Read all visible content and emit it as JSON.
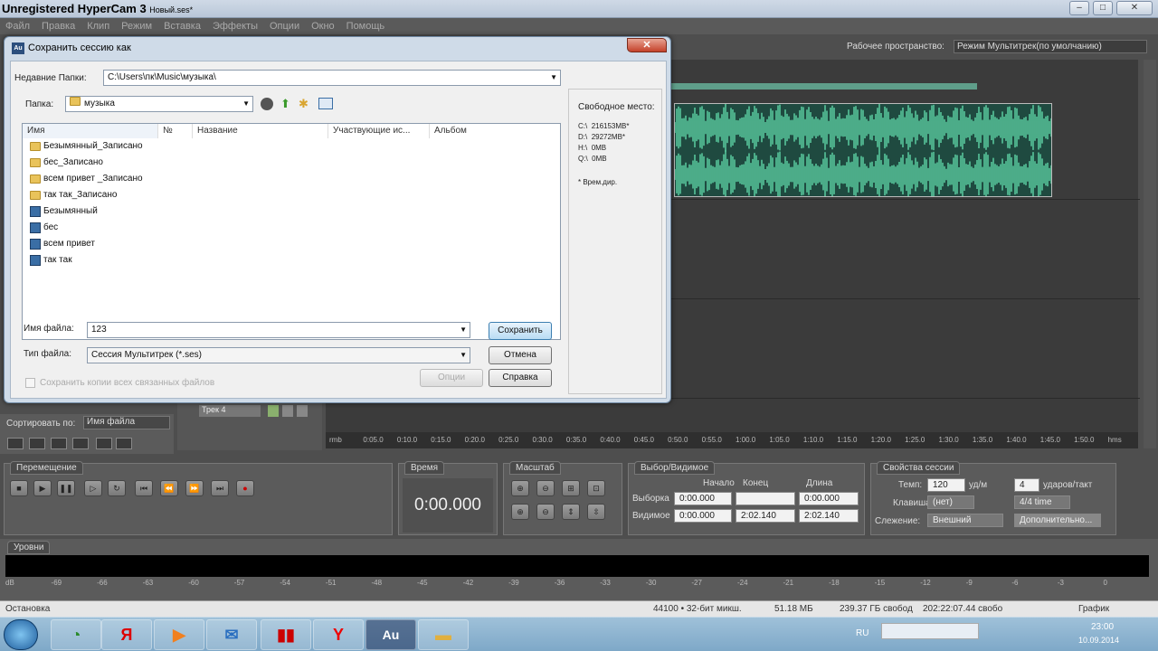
{
  "titlebar": {
    "app": "Unregistered HyperCam 3",
    "file": "Новый.ses*"
  },
  "menu": [
    "Файл",
    "Правка",
    "Клип",
    "Режим",
    "Вставка",
    "Эффекты",
    "Опции",
    "Окно",
    "Помощь"
  ],
  "workspace": {
    "label": "Рабочее пространство:",
    "value": "Режим Мультитрек(по умолчанию)"
  },
  "files_panel": {
    "sort_label": "Сортировать по:",
    "sort_value": "Имя файла"
  },
  "track": {
    "name": "Трек 4"
  },
  "ruler": [
    "rmb",
    "0:05.0",
    "0:10.0",
    "0:15.0",
    "0:20.0",
    "0:25.0",
    "0:30.0",
    "0:35.0",
    "0:40.0",
    "0:45.0",
    "0:50.0",
    "0:55.0",
    "1:00.0",
    "1:05.0",
    "1:10.0",
    "1:15.0",
    "1:20.0",
    "1:25.0",
    "1:30.0",
    "1:35.0",
    "1:40.0",
    "1:45.0",
    "1:50.0",
    "hms"
  ],
  "transport": {
    "title": "Перемещение"
  },
  "time": {
    "title": "Время",
    "value": "0:00.000"
  },
  "zoom": {
    "title": "Масштаб"
  },
  "selection": {
    "title": "Выбор/Видимое",
    "col_start": "Начало",
    "col_end": "Конец",
    "col_len": "Длина",
    "row_sel": "Выборка",
    "row_view": "Видимое",
    "sel_start": "0:00.000",
    "sel_end": "",
    "sel_len": "0:00.000",
    "view_start": "0:00.000",
    "view_end": "2:02.140",
    "view_len": "2:02.140"
  },
  "session": {
    "title": "Свойства сессии",
    "tempo_label": "Темп:",
    "tempo": "120",
    "bpm": "уд/м",
    "beats": "4",
    "beats_label": "ударов/такт",
    "key_label": "Клавиша:",
    "key": "(нет)",
    "time_sig": "4/4 time",
    "follow_label": "Слежение:",
    "follow": "Внешний",
    "advanced": "Дополнительно..."
  },
  "levels": {
    "title": "Уровни",
    "scale": [
      "dB",
      "-69",
      "-66",
      "-63",
      "-60",
      "-57",
      "-54",
      "-51",
      "-48",
      "-45",
      "-42",
      "-39",
      "-36",
      "-33",
      "-30",
      "-27",
      "-24",
      "-21",
      "-18",
      "-15",
      "-12",
      "-9",
      "-6",
      "-3",
      "0"
    ]
  },
  "status": {
    "state": "Остановка",
    "format": "44100 • 32-бит микш.",
    "size": "51.18 МБ",
    "free": "239.37 ГБ свобод",
    "free_time": "202:22:07.44 свобо",
    "mode": "График"
  },
  "taskbar": {
    "lang": "RU",
    "time": "23:00",
    "date": "10.09.2014",
    "apps": [
      "chart",
      "Я",
      "media",
      "mail",
      "pdf",
      "Y",
      "Au",
      "folder"
    ]
  },
  "dialog": {
    "title": "Сохранить сессию как",
    "recent_label": "Недавние Папки:",
    "recent_value": "C:\\Users\\пк\\Music\\музыка\\",
    "folder_label": "Папка:",
    "folder_value": "музыка",
    "columns": [
      "Имя",
      "№",
      "Название",
      "Участвующие ис...",
      "Альбом"
    ],
    "items": [
      {
        "name": "Безымянный_Записано",
        "type": "folder"
      },
      {
        "name": "бес_Записано",
        "type": "folder"
      },
      {
        "name": "всем привет _Записано",
        "type": "folder"
      },
      {
        "name": "так так_Записано",
        "type": "folder"
      },
      {
        "name": "Безымянный",
        "type": "file"
      },
      {
        "name": "бес",
        "type": "file"
      },
      {
        "name": "всем привет",
        "type": "file"
      },
      {
        "name": "так так",
        "type": "file"
      }
    ],
    "free_title": "Свободное место:",
    "drives": [
      {
        "d": "C:\\",
        "v": "216153MB*"
      },
      {
        "d": "D:\\",
        "v": "29272MB*"
      },
      {
        "d": "H:\\",
        "v": "0MB"
      },
      {
        "d": "Q:\\",
        "v": "0MB"
      }
    ],
    "temp_note": "* Врем.дир.",
    "filename_label": "Имя файла:",
    "filename": "123",
    "filetype_label": "Тип файла:",
    "filetype": "Сессия Мультитрек (*.ses)",
    "save": "Сохранить",
    "cancel": "Отмена",
    "options": "Опции",
    "help": "Справка",
    "copy_label": "Сохранить копии всех связанных файлов"
  }
}
